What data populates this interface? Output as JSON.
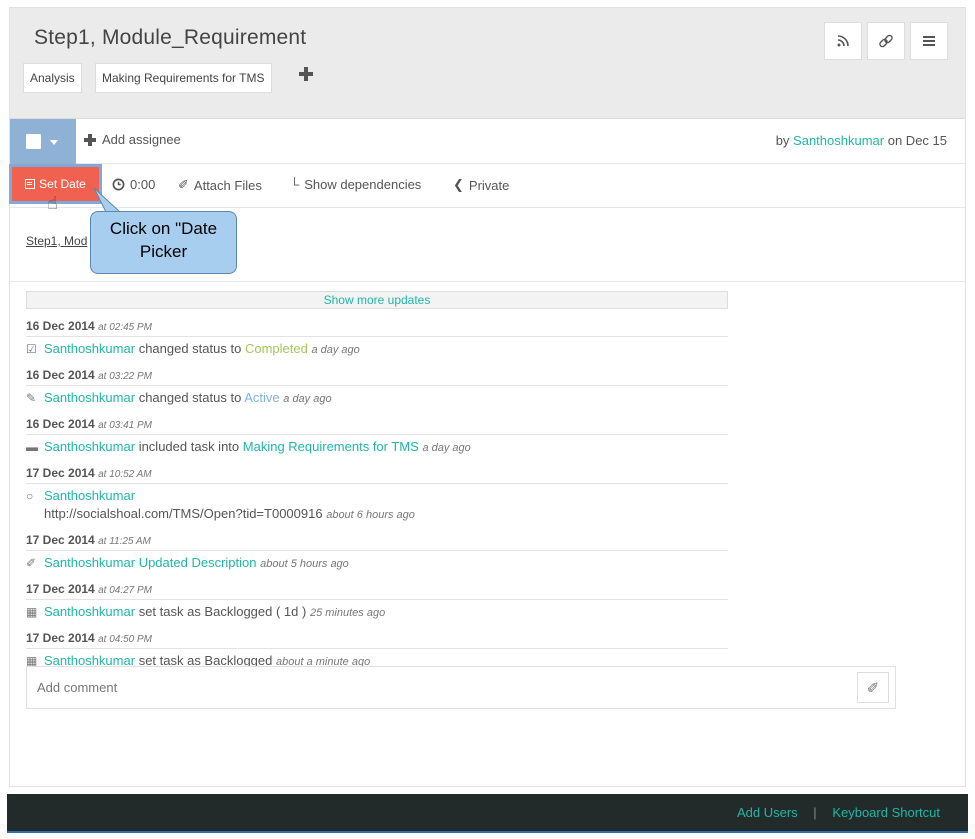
{
  "header": {
    "title": "Step1, Module_Requirement",
    "tags": [
      "Analysis",
      "Making Requirements for TMS"
    ],
    "buttons": {
      "rss": "rss-icon",
      "link": "link-icon",
      "menu": "menu-icon"
    }
  },
  "assignee": {
    "add_label": "Add assignee",
    "by_prefix": "by",
    "author": "Santhoshkumar",
    "on_text": "on Dec 15"
  },
  "actions": {
    "set_date": "Set Date",
    "time": "0:00",
    "attach": "Attach Files",
    "dependencies": "Show dependencies",
    "privacy": "Private"
  },
  "callout": {
    "line1": "Click on \"Date",
    "line2": "Picker"
  },
  "breadcrumb": "Step1, Mod",
  "feed": {
    "show_more": "Show more updates",
    "entries": [
      {
        "date": "16 Dec 2014",
        "time": "at 02:45 PM",
        "user": "Santhoshkumar",
        "text": "changed status to",
        "target": "Completed",
        "ago": "a day ago"
      },
      {
        "date": "16 Dec 2014",
        "time": "at 03:22 PM",
        "user": "Santhoshkumar",
        "text": "changed status to",
        "target": "Active",
        "ago": "a day ago"
      },
      {
        "date": "16 Dec 2014",
        "time": "at 03:41 PM",
        "user": "Santhoshkumar",
        "text": "included task into",
        "target": "Making Requirements for TMS",
        "ago": "a day ago"
      },
      {
        "date": "17 Dec 2014",
        "time": "at 10:52 AM",
        "user": "Santhoshkumar",
        "comment": "http://socialshoal.com/TMS/Open?tid=T0000916",
        "ago": "about 6 hours ago"
      },
      {
        "date": "17 Dec 2014",
        "time": "at 11:25 AM",
        "user": "Santhoshkumar",
        "target": "Updated Description",
        "ago": "about 5 hours ago"
      },
      {
        "date": "17 Dec 2014",
        "time": "at 04:27 PM",
        "user": "Santhoshkumar",
        "text": "set task as Backlogged ( 1d )",
        "ago": "25 minutes ago"
      },
      {
        "date": "17 Dec 2014",
        "time": "at 04:50 PM",
        "user": "Santhoshkumar",
        "text": "set task as Backlogged",
        "ago": "about a minute ago"
      }
    ]
  },
  "comment": {
    "placeholder": "Add comment"
  },
  "footer": {
    "add_users": "Add Users",
    "divider": "|",
    "shortcut": "Keyboard Shortcut"
  },
  "colors": {
    "accent": "#1fb7a6",
    "set_date_bg": "#f0624f",
    "completed": "#a4c65a",
    "active": "#7fb4e1",
    "footer_bg": "#222b2a"
  }
}
